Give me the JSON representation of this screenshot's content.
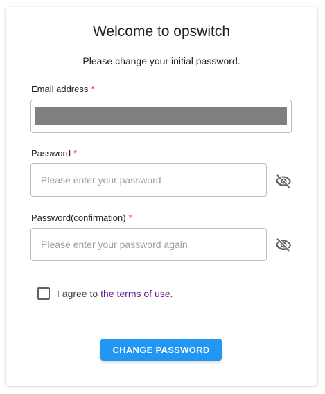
{
  "header": {
    "title": "Welcome to opswitch",
    "subtitle": "Please change your initial password."
  },
  "form": {
    "email": {
      "label": "Email address",
      "required_mark": "*"
    },
    "password": {
      "label": "Password",
      "required_mark": "*",
      "placeholder": "Please enter your password",
      "toggle_icon": "eye-off-icon"
    },
    "password_confirm": {
      "label": "Password(confirmation)",
      "required_mark": "*",
      "placeholder": "Please enter your password again",
      "toggle_icon": "eye-off-icon"
    },
    "agree": {
      "prefix": "I agree to",
      "link": "the terms of use",
      "suffix": "."
    },
    "submit_label": "CHANGE PASSWORD"
  },
  "colors": {
    "primary": "#2196f3",
    "required": "#e53935",
    "link": "#6a1b9a"
  }
}
